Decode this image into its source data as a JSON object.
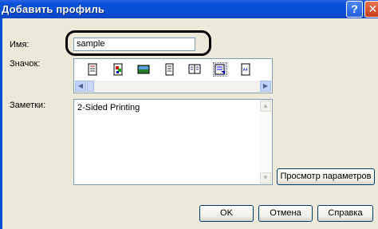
{
  "window": {
    "title": "Добавить профиль"
  },
  "form": {
    "name_label": "Имя:",
    "name_value": "sample",
    "icon_label": "Значок:",
    "notes_label": "Заметки:",
    "notes_value": "2-Sided Printing"
  },
  "icons": [
    "page-icon",
    "color-page-icon",
    "image-icon",
    "document-icon",
    "booklet-icon",
    "duplex-icon",
    "a4-icon"
  ],
  "buttons": {
    "preview": "Просмотр параметров",
    "ok": "OK",
    "cancel": "Отмена",
    "help": "Справка"
  },
  "colors": {
    "title_bar": "#0a4fd6",
    "dialog_bg": "#ece9d8",
    "highlight": "#000000"
  }
}
